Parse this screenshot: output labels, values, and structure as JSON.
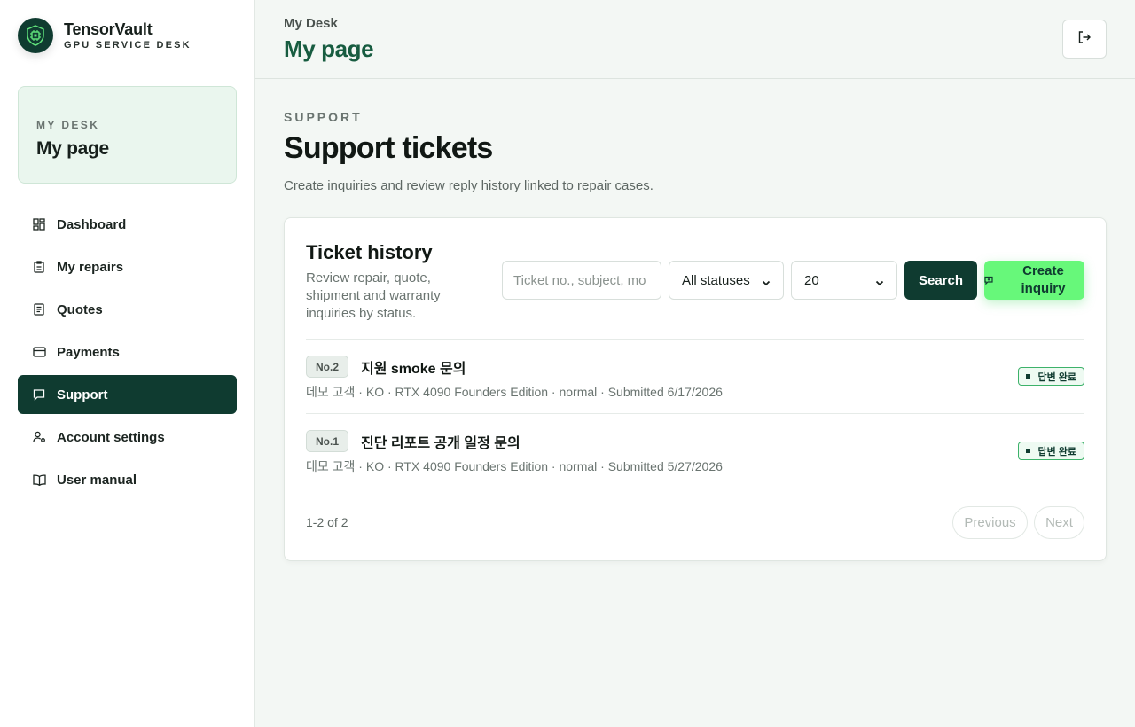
{
  "brand": {
    "name": "TensorVault",
    "subtitle": "GPU SERVICE DESK"
  },
  "sidebar": {
    "desk_eyebrow": "MY DESK",
    "desk_title": "My page",
    "items": [
      {
        "label": "Dashboard",
        "icon": "grid-icon",
        "active": false
      },
      {
        "label": "My repairs",
        "icon": "clipboard-icon",
        "active": false
      },
      {
        "label": "Quotes",
        "icon": "document-icon",
        "active": false
      },
      {
        "label": "Payments",
        "icon": "credit-card-icon",
        "active": false
      },
      {
        "label": "Support",
        "icon": "chat-icon",
        "active": true
      },
      {
        "label": "Account settings",
        "icon": "user-settings-icon",
        "active": false
      },
      {
        "label": "User manual",
        "icon": "book-icon",
        "active": false
      }
    ]
  },
  "header": {
    "breadcrumb": "My Desk",
    "title": "My page",
    "logout_icon": "logout-icon"
  },
  "section": {
    "eyebrow": "SUPPORT",
    "title": "Support tickets",
    "description": "Create inquiries and review reply history linked to repair cases."
  },
  "card": {
    "title": "Ticket history",
    "description": "Review repair, quote, shipment and warranty inquiries by status.",
    "search_placeholder": "Ticket no., subject, mo",
    "status_filter": "All statuses",
    "page_size": "20",
    "search_label": "Search",
    "create_label": "Create inquiry"
  },
  "tickets": [
    {
      "no": "No.2",
      "subject": "지원 smoke 문의",
      "meta": "데모 고객 · KO · RTX 4090 Founders Edition · normal · Submitted 6/17/2026",
      "status": "답변 완료"
    },
    {
      "no": "No.1",
      "subject": "진단 리포트 공개 일정 문의",
      "meta": "데모 고객 · KO · RTX 4090 Founders Edition · normal · Submitted 5/27/2026",
      "status": "답변 완료"
    }
  ],
  "pager": {
    "count": "1-2 of 2",
    "previous": "Previous",
    "next": "Next"
  },
  "colors": {
    "brand_dark": "#0f3b30",
    "accent_green": "#67f87a",
    "title_green": "#175c40"
  }
}
